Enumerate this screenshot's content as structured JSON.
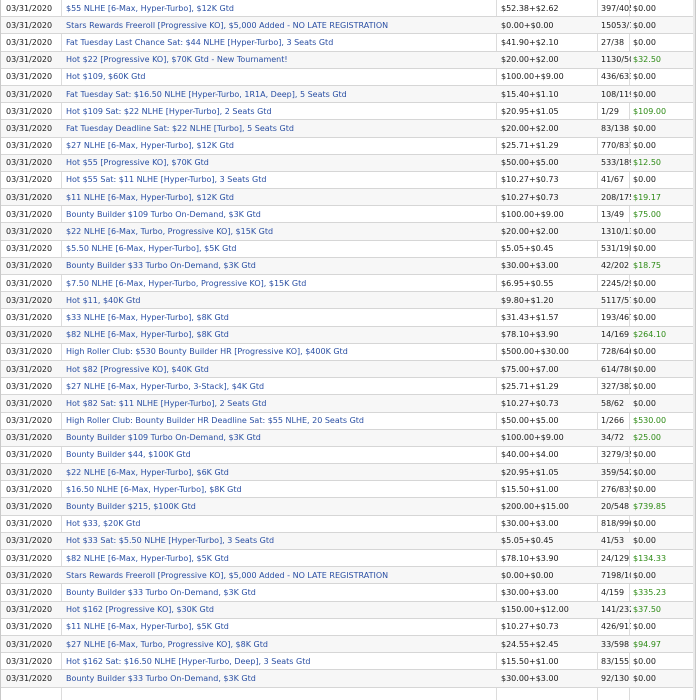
{
  "colors": {
    "link": "#2a4fa3",
    "win": "#2e8b16",
    "text": "#1a1a1a"
  },
  "rows": [
    {
      "date": "03/31/2020",
      "name": "$55 NLHE [6-Max, Hyper-Turbo], $12K Gtd",
      "buyin": "$52.38+$2.62",
      "rank": "397/405",
      "prize": "$0.00"
    },
    {
      "date": "03/31/2020",
      "name": "Stars Rewards Freeroll [Progressive KO], $5,000 Added - NO LATE REGISTRATION",
      "buyin": "$0.00+$0.00",
      "rank": "15053/15228",
      "prize": "$0.00"
    },
    {
      "date": "03/31/2020",
      "name": "Fat Tuesday Last Chance Sat: $44 NLHE [Hyper-Turbo], 3 Seats Gtd",
      "buyin": "$41.90+$2.10",
      "rank": "27/38",
      "prize": "$0.00"
    },
    {
      "date": "03/31/2020",
      "name": "Hot $22 [Progressive KO], $70K Gtd - New Tournament!",
      "buyin": "$20.00+$2.00",
      "rank": "1130/5052",
      "prize": "$32.50",
      "win": true
    },
    {
      "date": "03/31/2020",
      "name": "Hot $109, $60K Gtd",
      "buyin": "$100.00+$9.00",
      "rank": "436/633",
      "prize": "$0.00"
    },
    {
      "date": "03/31/2020",
      "name": "Fat Tuesday Sat: $16.50 NLHE [Hyper-Turbo, 1R1A, Deep], 5 Seats Gtd",
      "buyin": "$15.40+$1.10",
      "rank": "108/119",
      "prize": "$0.00"
    },
    {
      "date": "03/31/2020",
      "name": "Hot $109 Sat: $22 NLHE [Hyper-Turbo], 2 Seats Gtd",
      "buyin": "$20.95+$1.05",
      "rank": "1/29",
      "prize": "$109.00",
      "win": true
    },
    {
      "date": "03/31/2020",
      "name": "Fat Tuesday Deadline Sat: $22 NLHE [Turbo], 5 Seats Gtd",
      "buyin": "$20.00+$2.00",
      "rank": "83/138",
      "prize": "$0.00"
    },
    {
      "date": "03/31/2020",
      "name": "$27 NLHE [6-Max, Hyper-Turbo], $12K Gtd",
      "buyin": "$25.71+$1.29",
      "rank": "770/837",
      "prize": "$0.00"
    },
    {
      "date": "03/31/2020",
      "name": "Hot $55 [Progressive KO], $70K Gtd",
      "buyin": "$50.00+$5.00",
      "rank": "533/1892",
      "prize": "$12.50",
      "win": true
    },
    {
      "date": "03/31/2020",
      "name": "Hot $55 Sat: $11 NLHE [Hyper-Turbo], 3 Seats Gtd",
      "buyin": "$10.27+$0.73",
      "rank": "41/67",
      "prize": "$0.00"
    },
    {
      "date": "03/31/2020",
      "name": "$11 NLHE [6-Max, Hyper-Turbo], $12K Gtd",
      "buyin": "$10.27+$0.73",
      "rank": "208/1753",
      "prize": "$19.17",
      "win": true
    },
    {
      "date": "03/31/2020",
      "name": "Bounty Builder $109 Turbo On-Demand, $3K Gtd",
      "buyin": "$100.00+$9.00",
      "rank": "13/49",
      "prize": "$75.00",
      "win": true
    },
    {
      "date": "03/31/2020",
      "name": "$22 NLHE [6-Max, Turbo, Progressive KO], $15K Gtd",
      "buyin": "$20.00+$2.00",
      "rank": "1310/1338",
      "prize": "$0.00"
    },
    {
      "date": "03/31/2020",
      "name": "$5.50 NLHE [6-Max, Hyper-Turbo], $5K Gtd",
      "buyin": "$5.05+$0.45",
      "rank": "531/1987",
      "prize": "$0.00"
    },
    {
      "date": "03/31/2020",
      "name": "Bounty Builder $33 Turbo On-Demand, $3K Gtd",
      "buyin": "$30.00+$3.00",
      "rank": "42/202",
      "prize": "$18.75",
      "win": true
    },
    {
      "date": "03/31/2020",
      "name": "$7.50 NLHE [6-Max, Hyper-Turbo, Progressive KO], $15K Gtd",
      "buyin": "$6.95+$0.55",
      "rank": "2245/2954",
      "prize": "$0.00"
    },
    {
      "date": "03/31/2020",
      "name": "Hot $11, $40K Gtd",
      "buyin": "$9.80+$1.20",
      "rank": "5117/5783",
      "prize": "$0.00"
    },
    {
      "date": "03/31/2020",
      "name": "$33 NLHE [6-Max, Hyper-Turbo], $8K Gtd",
      "buyin": "$31.43+$1.57",
      "rank": "193/467",
      "prize": "$0.00"
    },
    {
      "date": "03/31/2020",
      "name": "$82 NLHE [6-Max, Hyper-Turbo], $8K Gtd",
      "buyin": "$78.10+$3.90",
      "rank": "14/169",
      "prize": "$264.10",
      "win": true
    },
    {
      "date": "03/31/2020",
      "name": "High Roller Club: $530 Bounty Builder HR [Progressive KO], $400K Gtd",
      "buyin": "$500.00+$30.00",
      "rank": "728/646",
      "prize": "$0.00"
    },
    {
      "date": "03/31/2020",
      "name": "Hot $82 [Progressive KO], $40K Gtd",
      "buyin": "$75.00+$7.00",
      "rank": "614/780",
      "prize": "$0.00"
    },
    {
      "date": "03/31/2020",
      "name": "$27 NLHE [6-Max, Hyper-Turbo, 3-Stack], $4K Gtd",
      "buyin": "$25.71+$1.29",
      "rank": "327/382",
      "prize": "$0.00"
    },
    {
      "date": "03/31/2020",
      "name": "Hot $82 Sat: $11 NLHE [Hyper-Turbo], 2 Seats Gtd",
      "buyin": "$10.27+$0.73",
      "rank": "58/62",
      "prize": "$0.00"
    },
    {
      "date": "03/31/2020",
      "name": "High Roller Club: Bounty Builder HR Deadline Sat: $55 NLHE, 20 Seats Gtd",
      "buyin": "$50.00+$5.00",
      "rank": "1/266",
      "prize": "$530.00",
      "win": true
    },
    {
      "date": "03/31/2020",
      "name": "Bounty Builder $109 Turbo On-Demand, $3K Gtd",
      "buyin": "$100.00+$9.00",
      "rank": "34/72",
      "prize": "$25.00",
      "win": true
    },
    {
      "date": "03/31/2020",
      "name": "Bounty Builder $44, $100K Gtd",
      "buyin": "$40.00+$4.00",
      "rank": "3279/3535",
      "prize": "$0.00"
    },
    {
      "date": "03/31/2020",
      "name": "$22 NLHE [6-Max, Hyper-Turbo], $6K Gtd",
      "buyin": "$20.95+$1.05",
      "rank": "359/542",
      "prize": "$0.00"
    },
    {
      "date": "03/31/2020",
      "name": "$16.50 NLHE [6-Max, Hyper-Turbo], $8K Gtd",
      "buyin": "$15.50+$1.00",
      "rank": "276/835",
      "prize": "$0.00"
    },
    {
      "date": "03/31/2020",
      "name": "Bounty Builder $215, $100K Gtd",
      "buyin": "$200.00+$15.00",
      "rank": "20/548",
      "prize": "$739.85",
      "win": true
    },
    {
      "date": "03/31/2020",
      "name": "Hot $33, $20K Gtd",
      "buyin": "$30.00+$3.00",
      "rank": "818/996",
      "prize": "$0.00"
    },
    {
      "date": "03/31/2020",
      "name": "Hot $33 Sat: $5.50 NLHE [Hyper-Turbo], 3 Seats Gtd",
      "buyin": "$5.05+$0.45",
      "rank": "41/53",
      "prize": "$0.00"
    },
    {
      "date": "03/31/2020",
      "name": "$82 NLHE [6-Max, Hyper-Turbo], $5K Gtd",
      "buyin": "$78.10+$3.90",
      "rank": "24/129",
      "prize": "$134.33",
      "win": true
    },
    {
      "date": "03/31/2020",
      "name": "Stars Rewards Freeroll [Progressive KO], $5,000 Added - NO LATE REGISTRATION",
      "buyin": "$0.00+$0.00",
      "rank": "7198/10376",
      "prize": "$0.00"
    },
    {
      "date": "03/31/2020",
      "name": "Bounty Builder $33 Turbo On-Demand, $3K Gtd",
      "buyin": "$30.00+$3.00",
      "rank": "4/159",
      "prize": "$335.23",
      "win": true
    },
    {
      "date": "03/31/2020",
      "name": "Hot $162 [Progressive KO], $30K Gtd",
      "buyin": "$150.00+$12.00",
      "rank": "141/232",
      "prize": "$37.50",
      "win": true
    },
    {
      "date": "03/31/2020",
      "name": "$11 NLHE [6-Max, Hyper-Turbo], $5K Gtd",
      "buyin": "$10.27+$0.73",
      "rank": "426/911",
      "prize": "$0.00"
    },
    {
      "date": "03/31/2020",
      "name": "$27 NLHE [6-Max, Turbo, Progressive KO], $8K Gtd",
      "buyin": "$24.55+$2.45",
      "rank": "33/598",
      "prize": "$94.97",
      "win": true
    },
    {
      "date": "03/31/2020",
      "name": "Hot $162 Sat: $16.50 NLHE [Hyper-Turbo, Deep], 3 Seats Gtd",
      "buyin": "$15.50+$1.00",
      "rank": "83/155",
      "prize": "$0.00"
    },
    {
      "date": "03/31/2020",
      "name": "Bounty Builder $33 Turbo On-Demand, $3K Gtd",
      "buyin": "$30.00+$3.00",
      "rank": "92/130",
      "prize": "$0.00"
    }
  ]
}
